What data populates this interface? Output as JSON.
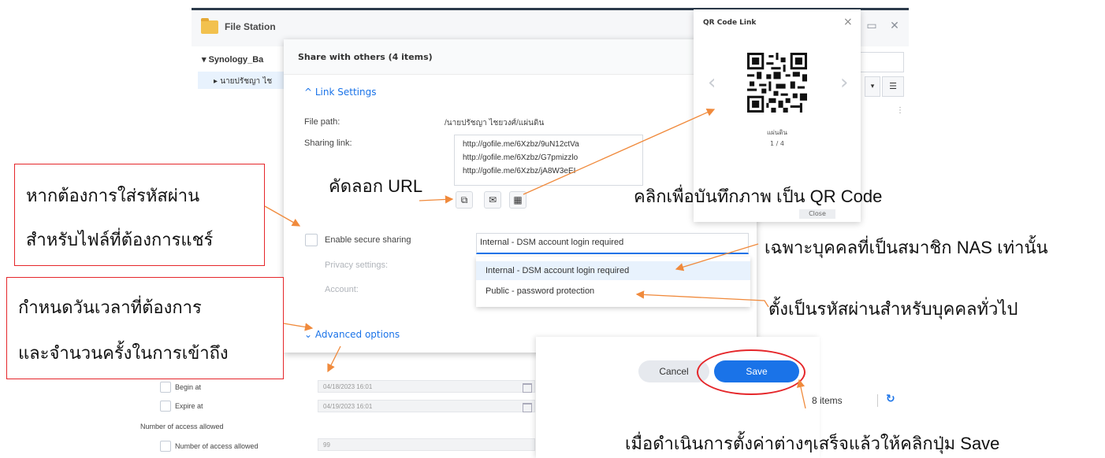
{
  "file_station": {
    "title": "File Station",
    "tree_root": "▾ Synology_Ba",
    "tree_child": "▸ นายปรัชญา ไช"
  },
  "share_dialog": {
    "title": "Share with others (4 items)",
    "link_settings": "^  Link Settings",
    "file_path_label": "File path:",
    "file_path_value": "/นายปรัชญา ไชยวงศ์/แผ่นดิน",
    "sharing_link_label": "Sharing link:",
    "links": [
      "http://gofile.me/6Xzbz/9uN12ctVa",
      "http://gofile.me/6Xzbz/G7pmizzlo",
      "http://gofile.me/6Xzbz/jA8W3eEI"
    ],
    "enable_secure_label": "Enable secure sharing",
    "privacy_label": "Privacy settings:",
    "account_label": "Account:",
    "dropdown_value": "Internal - DSM account login required",
    "dropdown_options": [
      "Internal - DSM account login required",
      "Public - password protection"
    ],
    "advanced_options": "⌄  Advanced options"
  },
  "advanced": {
    "begin_label": "Begin at",
    "begin_value": "04/18/2023 16:01",
    "expire_label": "Expire at",
    "expire_value": "04/19/2023 16:01",
    "access_heading": "Number of access allowed",
    "access_label": "Number of access allowed",
    "access_value": "99"
  },
  "qr_panel": {
    "title": "QR Code Link",
    "close": "×",
    "file_name": "แผ่นดิน",
    "page": "1 / 4",
    "close_button": "Close"
  },
  "actions": {
    "cancel": "Cancel",
    "save": "Save",
    "items_count": "8 items"
  },
  "annotations": {
    "copy_url": "คัดลอก URL",
    "qr_save": "คลิกเพื่อบันทึกภาพ เป็น QR Code",
    "password_box": [
      "หากต้องการใส่รหัสผ่าน",
      "สำหรับไฟล์ที่ต้องการแชร์"
    ],
    "date_box": [
      "กำหนดวันเวลาที่ต้องการ",
      "และจำนวนครั้งในการเข้าถึง"
    ],
    "members_only": "เฉพาะบุคคลที่เป็นสมาชิก NAS เท่านั้น",
    "public_password": "ตั้งเป็นรหัสผ่านสำหรับบุคคลทั่วไป",
    "click_save": "เมื่อดำเนินการตั้งค่าต่างๆเสร็จแล้วให้คลิกปุ่ม Save"
  },
  "colors": {
    "accent": "#1a73e8",
    "annotation_red": "#e5262a",
    "arrow_orange": "#f08a3c"
  }
}
